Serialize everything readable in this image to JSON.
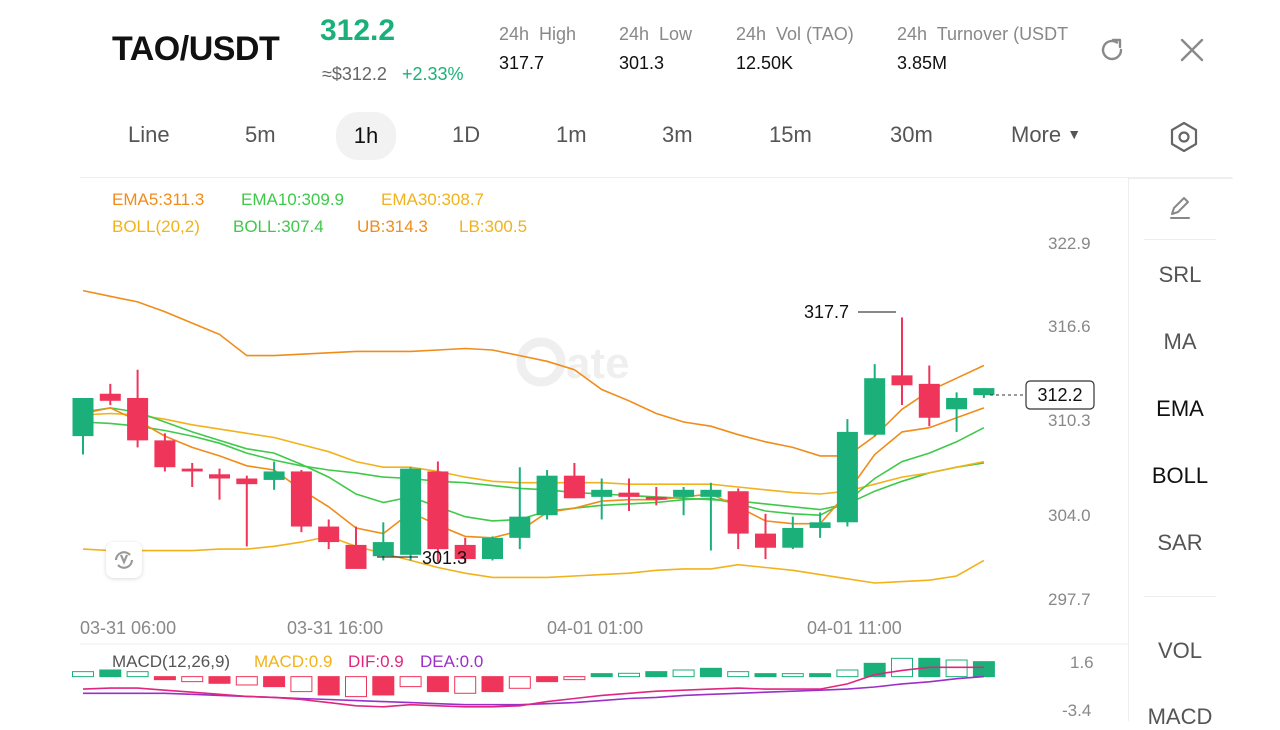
{
  "header": {
    "pair": "TAO/USDT",
    "price": "312.2",
    "usd_price": "≈$312.2",
    "change": "+2.33%",
    "stats": [
      {
        "label": "24h  High",
        "value": "317.7"
      },
      {
        "label": "24h  Low",
        "value": "301.3"
      },
      {
        "label": "24h  Vol (TAO)",
        "value": "12.50K"
      },
      {
        "label": "24h  Turnover (USDT",
        "value": "3.85M"
      }
    ],
    "icons": {
      "refresh": "refresh-icon",
      "close": "close-icon"
    }
  },
  "timeframes": [
    "Line",
    "5m",
    "1h",
    "1D",
    "1m",
    "3m",
    "15m",
    "30m"
  ],
  "active_timeframe": "1h",
  "more_label": "More",
  "legend": {
    "ema5": "EMA5:311.3",
    "ema10": "EMA10:309.9",
    "ema30": "EMA30:308.7",
    "boll_params": "BOLL(20,2)",
    "boll": "BOLL:307.4",
    "ub": "UB:314.3",
    "lb": "LB:300.5"
  },
  "y_axis": [
    "322.9",
    "316.6",
    "310.3",
    "304.0",
    "297.7"
  ],
  "x_axis": [
    "03-31 06:00",
    "03-31 16:00",
    "04-01 01:00",
    "04-01 11:00"
  ],
  "annotations": {
    "high": "317.7",
    "low": "301.3",
    "last": "312.2"
  },
  "macd": {
    "label": "MACD(12,26,9)",
    "macd": "MACD:0.9",
    "dif": "DIF:0.9",
    "dea": "DEA:0.0",
    "axis_top": "1.6",
    "axis_bottom": "-3.4"
  },
  "side_menu": [
    "SRL",
    "MA",
    "EMA",
    "BOLL",
    "SAR",
    "VOL",
    "MACD"
  ],
  "colors": {
    "up": "#1bb07a",
    "down": "#f0355a",
    "ema5": "#f08c1a",
    "ema10": "#3fc94a",
    "ema30": "#f2b21b",
    "dif": "#e0267e",
    "dea": "#9b2fc9"
  },
  "chart_data": {
    "type": "candlestick",
    "candles": [
      {
        "o": 309.3,
        "h": 312.0,
        "l": 308.0,
        "c": 312.0
      },
      {
        "o": 312.3,
        "h": 313.0,
        "l": 311.5,
        "c": 311.8
      },
      {
        "o": 312.0,
        "h": 314.0,
        "l": 308.5,
        "c": 309.0
      },
      {
        "o": 309.0,
        "h": 309.5,
        "l": 306.8,
        "c": 307.1
      },
      {
        "o": 307.0,
        "h": 307.4,
        "l": 305.7,
        "c": 306.8
      },
      {
        "o": 306.6,
        "h": 307.0,
        "l": 304.8,
        "c": 306.3
      },
      {
        "o": 306.3,
        "h": 306.5,
        "l": 301.5,
        "c": 305.9
      },
      {
        "o": 306.2,
        "h": 307.5,
        "l": 305.5,
        "c": 306.8
      },
      {
        "o": 306.8,
        "h": 306.9,
        "l": 302.5,
        "c": 302.9
      },
      {
        "o": 302.9,
        "h": 303.4,
        "l": 301.3,
        "c": 301.8
      },
      {
        "o": 301.6,
        "h": 302.9,
        "l": 301.3,
        "c": 299.9
      },
      {
        "o": 300.8,
        "h": 303.2,
        "l": 300.5,
        "c": 301.8
      },
      {
        "o": 300.9,
        "h": 307.1,
        "l": 300.5,
        "c": 307.0
      },
      {
        "o": 306.8,
        "h": 307.5,
        "l": 300.4,
        "c": 301.3
      },
      {
        "o": 301.6,
        "h": 302.1,
        "l": 300.3,
        "c": 300.6
      },
      {
        "o": 300.6,
        "h": 302.2,
        "l": 300.5,
        "c": 302.1
      },
      {
        "o": 302.1,
        "h": 307.1,
        "l": 301.3,
        "c": 303.6
      },
      {
        "o": 303.7,
        "h": 306.9,
        "l": 303.4,
        "c": 306.5
      },
      {
        "o": 306.5,
        "h": 307.4,
        "l": 304.9,
        "c": 304.9
      },
      {
        "o": 305.0,
        "h": 306.3,
        "l": 303.4,
        "c": 305.5
      },
      {
        "o": 305.3,
        "h": 306.3,
        "l": 304.0,
        "c": 305.0
      },
      {
        "o": 305.0,
        "h": 305.7,
        "l": 304.4,
        "c": 304.8
      },
      {
        "o": 305.0,
        "h": 305.7,
        "l": 303.7,
        "c": 305.5
      },
      {
        "o": 305.0,
        "h": 306.0,
        "l": 301.2,
        "c": 305.5
      },
      {
        "o": 305.4,
        "h": 305.6,
        "l": 301.3,
        "c": 302.4
      },
      {
        "o": 302.4,
        "h": 303.8,
        "l": 300.6,
        "c": 301.4
      },
      {
        "o": 301.4,
        "h": 303.6,
        "l": 301.3,
        "c": 302.8
      },
      {
        "o": 302.8,
        "h": 303.9,
        "l": 302.1,
        "c": 303.2
      },
      {
        "o": 303.2,
        "h": 310.5,
        "l": 302.9,
        "c": 309.6
      },
      {
        "o": 309.4,
        "h": 314.4,
        "l": 309.3,
        "c": 313.4
      },
      {
        "o": 313.6,
        "h": 317.7,
        "l": 311.5,
        "c": 312.9
      },
      {
        "o": 313.0,
        "h": 314.3,
        "l": 310.0,
        "c": 310.6
      },
      {
        "o": 311.2,
        "h": 312.4,
        "l": 309.6,
        "c": 312.0
      },
      {
        "o": 312.2,
        "h": 312.7,
        "l": 312.0,
        "c": 312.7
      }
    ],
    "ema5": [
      310.9,
      311.3,
      310.4,
      309.3,
      308.5,
      307.9,
      307.2,
      306.9,
      305.5,
      304.3,
      302.8,
      302.4,
      303.9,
      303.0,
      302.2,
      302.1,
      302.6,
      303.9,
      304.2,
      304.7,
      304.8,
      304.8,
      305.0,
      305.2,
      304.3,
      303.3,
      303.1,
      303.1,
      305.3,
      308.0,
      309.6,
      309.9,
      310.6,
      311.3
    ],
    "ema10": [
      311.0,
      311.3,
      311.0,
      310.3,
      309.6,
      309.0,
      308.4,
      308.1,
      307.3,
      306.4,
      305.2,
      304.6,
      305.0,
      304.3,
      303.6,
      303.3,
      303.4,
      304.0,
      304.2,
      304.4,
      304.5,
      304.6,
      304.8,
      304.9,
      304.5,
      304.0,
      303.8,
      303.7,
      304.7,
      306.3,
      307.5,
      308.1,
      308.9,
      309.9
    ],
    "ema30": [
      310.8,
      310.9,
      310.8,
      310.5,
      310.1,
      309.8,
      309.5,
      309.2,
      308.7,
      308.2,
      307.5,
      307.1,
      307.1,
      306.8,
      306.4,
      306.1,
      306.0,
      306.0,
      306.0,
      306.0,
      305.9,
      305.9,
      305.9,
      305.9,
      305.7,
      305.5,
      305.3,
      305.2,
      305.4,
      305.9,
      306.4,
      306.7,
      307.1,
      307.5
    ],
    "boll_ub": [
      319.6,
      319.2,
      318.8,
      318.1,
      317.3,
      316.5,
      315.0,
      315.0,
      315.1,
      315.2,
      315.3,
      315.3,
      315.3,
      315.4,
      315.5,
      315.4,
      315.0,
      314.6,
      314.0,
      312.6,
      311.8,
      310.9,
      310.3,
      310.0,
      309.4,
      308.9,
      308.5,
      307.9,
      307.9,
      309.3,
      311.2,
      312.5,
      313.4,
      314.3
    ],
    "boll_mid": [
      310.3,
      310.2,
      310.0,
      309.7,
      309.3,
      308.8,
      308.1,
      307.6,
      307.2,
      306.9,
      306.7,
      306.4,
      306.3,
      306.1,
      306.0,
      305.8,
      305.6,
      305.5,
      305.3,
      305.2,
      305.1,
      305.0,
      304.9,
      304.8,
      304.7,
      304.5,
      304.3,
      304.1,
      304.5,
      305.4,
      306.1,
      306.7,
      307.1,
      307.4
    ],
    "boll_lb": [
      301.3,
      301.2,
      301.2,
      301.2,
      301.2,
      301.3,
      301.3,
      301.5,
      301.8,
      302.2,
      301.5,
      301.0,
      300.5,
      300.0,
      299.6,
      299.3,
      299.3,
      299.3,
      299.4,
      299.5,
      299.6,
      299.8,
      299.9,
      299.9,
      300.2,
      300.0,
      299.8,
      299.5,
      299.2,
      298.9,
      299.0,
      299.1,
      299.4,
      300.5
    ],
    "macd_hist": [
      0.3,
      0.4,
      0.3,
      -0.1,
      -0.3,
      -0.4,
      -0.5,
      -0.6,
      -0.9,
      -1.1,
      -1.2,
      -1.1,
      -0.6,
      -0.9,
      -1.0,
      -0.9,
      -0.7,
      -0.3,
      -0.1,
      0.1,
      0.2,
      0.3,
      0.4,
      0.5,
      0.3,
      0.1,
      0.1,
      0.1,
      0.4,
      0.8,
      1.1,
      1.1,
      1.0,
      0.9
    ],
    "dif": [
      -1.2,
      -1.1,
      -1.1,
      -1.3,
      -1.5,
      -1.7,
      -1.9,
      -2.0,
      -2.2,
      -2.5,
      -2.8,
      -2.9,
      -2.7,
      -2.8,
      -2.9,
      -2.9,
      -2.8,
      -2.4,
      -2.1,
      -1.8,
      -1.6,
      -1.4,
      -1.3,
      -1.2,
      -1.1,
      -1.2,
      -1.2,
      -1.2,
      -0.7,
      0.2,
      0.6,
      0.9,
      0.9,
      0.9
    ],
    "dea": [
      -1.6,
      -1.6,
      -1.6,
      -1.6,
      -1.7,
      -1.8,
      -1.9,
      -2.0,
      -2.1,
      -2.2,
      -2.3,
      -2.4,
      -2.5,
      -2.6,
      -2.7,
      -2.7,
      -2.7,
      -2.6,
      -2.5,
      -2.3,
      -2.1,
      -2.0,
      -1.8,
      -1.7,
      -1.6,
      -1.5,
      -1.4,
      -1.3,
      -1.2,
      -1.0,
      -0.7,
      -0.5,
      -0.2,
      0.0
    ],
    "price_axis": [
      297.7,
      322.9
    ],
    "macd_axis": [
      -3.4,
      1.6
    ]
  }
}
